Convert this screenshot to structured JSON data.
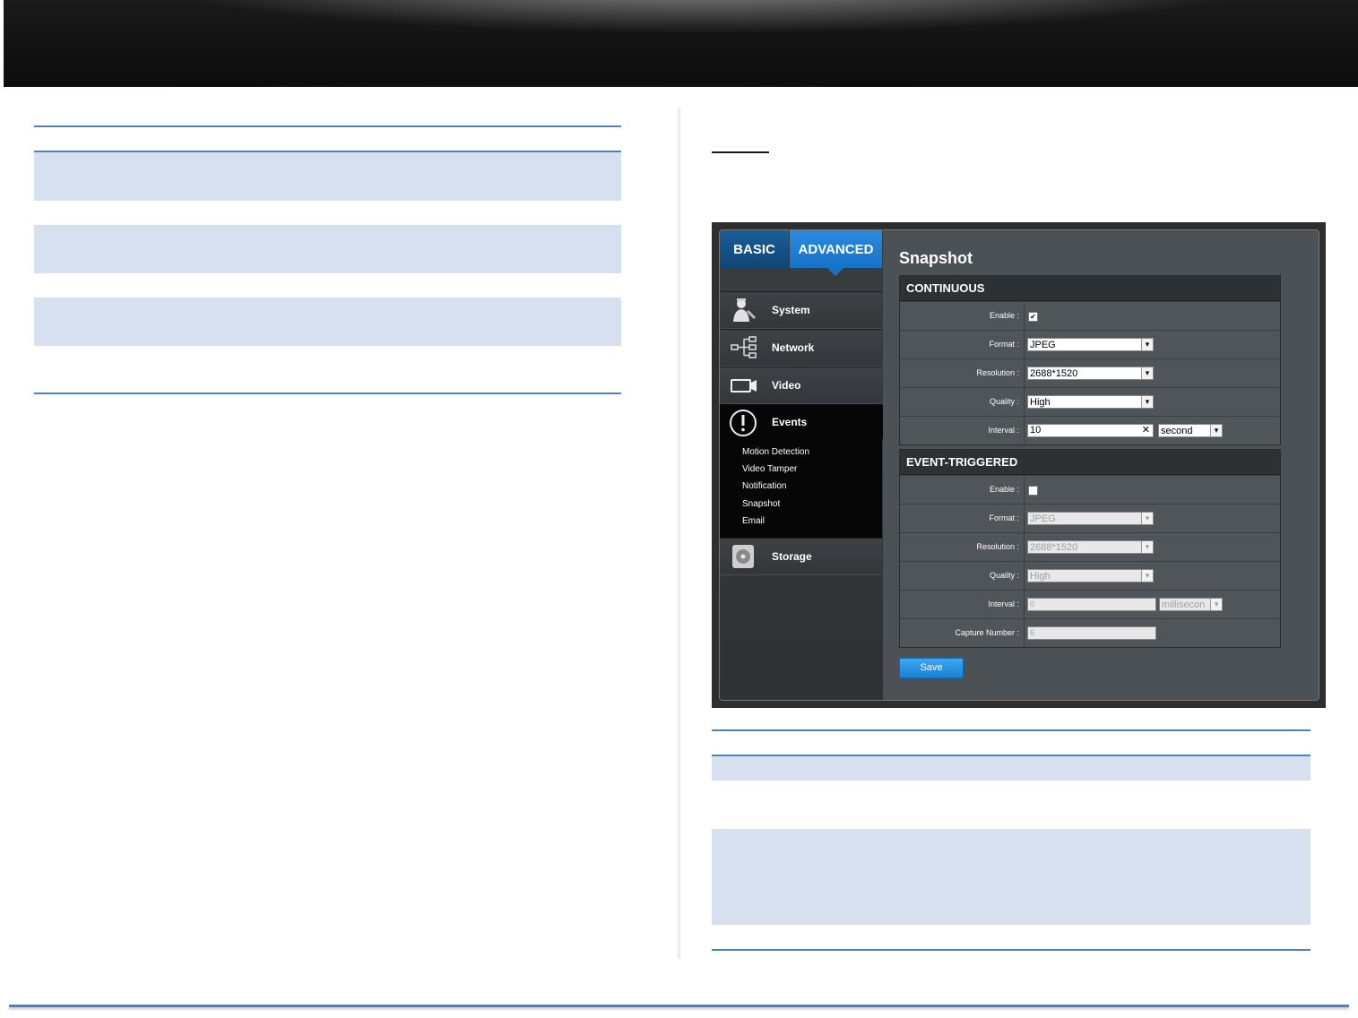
{
  "ui": {
    "tabs": {
      "basic": "BASIC",
      "advanced": "ADVANCED"
    },
    "nav": {
      "system": "System",
      "network": "Network",
      "video": "Video",
      "events": "Events",
      "storage": "Storage",
      "event_subitems": [
        "Motion Detection",
        "Video Tamper",
        "Notification",
        "Snapshot",
        "Email"
      ]
    },
    "page_title": "Snapshot",
    "continuous": {
      "heading": "CONTINUOUS",
      "enable_label": "Enable :",
      "format_label": "Format :",
      "format_value": "JPEG",
      "resolution_label": "Resolution :",
      "resolution_value": "2688*1520",
      "quality_label": "Quality :",
      "quality_value": "High",
      "interval_label": "Interval :",
      "interval_value": "10",
      "interval_unit": "second"
    },
    "event_triggered": {
      "heading": "EVENT-TRIGGERED",
      "enable_label": "Enable :",
      "format_label": "Format :",
      "format_value": "JPEG",
      "resolution_label": "Resolution :",
      "resolution_value": "2688*1520",
      "quality_label": "Quality :",
      "quality_value": "High",
      "interval_label": "Interval :",
      "interval_value": "0",
      "interval_unit": "millisecon",
      "capture_label": "Capture Number :",
      "capture_value": "6"
    },
    "save_label": "Save"
  }
}
